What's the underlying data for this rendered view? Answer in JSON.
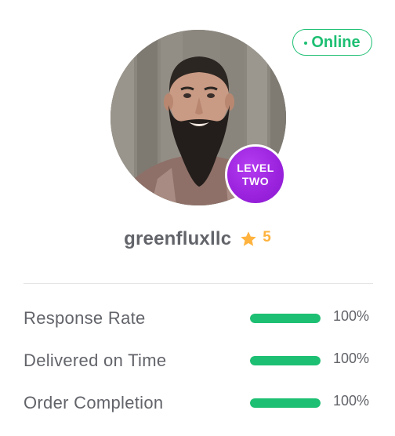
{
  "status": {
    "label": "Online",
    "color": "#1dbf73"
  },
  "profile": {
    "username": "greenfluxllc",
    "level_line1": "LEVEL",
    "level_line2": "TWO",
    "rating": "5",
    "rating_icon": "star-icon",
    "level_color": "#9a22dd",
    "rating_color": "#ffb33e"
  },
  "stats": [
    {
      "label": "Response Rate",
      "value": "100%",
      "fraction": 1.0
    },
    {
      "label": "Delivered on Time",
      "value": "100%",
      "fraction": 1.0
    },
    {
      "label": "Order Completion",
      "value": "100%",
      "fraction": 1.0
    }
  ]
}
